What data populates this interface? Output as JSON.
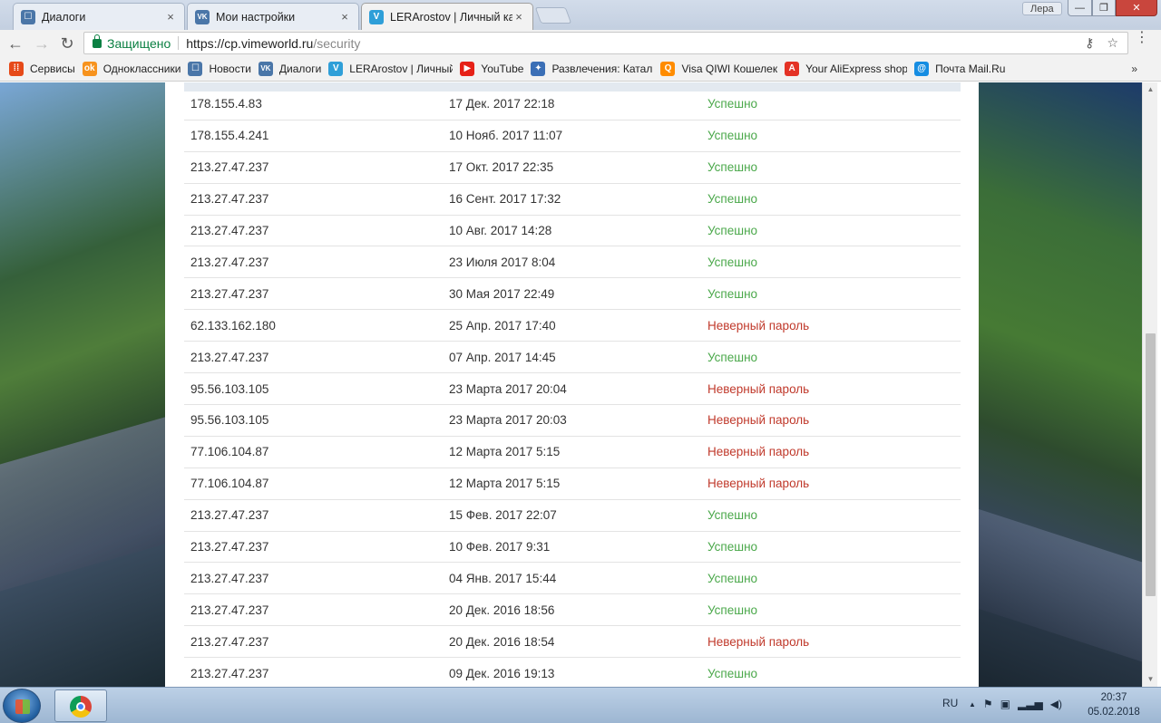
{
  "tabs": [
    {
      "title": "Диалоги",
      "close": "×",
      "icon": "vk-messages-icon",
      "color": "#4a76a8",
      "glyph": "☐"
    },
    {
      "title": "Мои настройки",
      "close": "×",
      "icon": "vk-icon",
      "color": "#4a76a8",
      "glyph": "VK"
    },
    {
      "title": "LERArostov | Личный ка",
      "close": "×",
      "icon": "vimeworld-icon",
      "color": "#2f9fd8",
      "glyph": "V"
    }
  ],
  "window": {
    "user": "Лера",
    "min": "—",
    "max": "❐",
    "close": "✕"
  },
  "toolbar": {
    "secure_label": "Защищено",
    "url_host": "https://cp.vimeworld.ru",
    "url_path": "/security",
    "back": "←",
    "forward": "→",
    "reload": "↻",
    "key_icon": "⚷",
    "star_icon": "☆",
    "menu": "⋮"
  },
  "bookmarks": {
    "items": [
      {
        "label": "Сервисы",
        "icon": "apps-grid-icon",
        "color": "#e64a19",
        "glyph": "⁞⁞"
      },
      {
        "label": "Одноклассники",
        "icon": "odnoklassniki-icon",
        "color": "#f7931e",
        "glyph": "ok"
      },
      {
        "label": "Новости",
        "icon": "vk-news-icon",
        "color": "#4a76a8",
        "glyph": "☐"
      },
      {
        "label": "Диалоги",
        "icon": "vk-icon",
        "color": "#4a76a8",
        "glyph": "VK"
      },
      {
        "label": "LERArostov | Личный",
        "icon": "vimeworld-icon",
        "color": "#2f9fd8",
        "glyph": "V"
      },
      {
        "label": "YouTube",
        "icon": "youtube-icon",
        "color": "#e62117",
        "glyph": "▶"
      },
      {
        "label": "Развлечения: Катало",
        "icon": "entertainment-icon",
        "color": "#3b6fb6",
        "glyph": "✦"
      },
      {
        "label": "Visa QIWI Кошелек",
        "icon": "qiwi-icon",
        "color": "#ff8c00",
        "glyph": "Q"
      },
      {
        "label": "Your AliExpress shop",
        "icon": "aliexpress-icon",
        "color": "#e43225",
        "glyph": "A"
      },
      {
        "label": "Почта Mail.Ru",
        "icon": "mailru-icon",
        "color": "#168de2",
        "glyph": "@"
      }
    ],
    "more": "»"
  },
  "security_log": {
    "rows": [
      {
        "ip": "178.155.4.83",
        "date": "17 Дек. 2017 22:18",
        "status": "Успешно",
        "ok": true
      },
      {
        "ip": "178.155.4.241",
        "date": "10 Нояб. 2017 11:07",
        "status": "Успешно",
        "ok": true
      },
      {
        "ip": "213.27.47.237",
        "date": "17 Окт. 2017 22:35",
        "status": "Успешно",
        "ok": true
      },
      {
        "ip": "213.27.47.237",
        "date": "16 Сент. 2017 17:32",
        "status": "Успешно",
        "ok": true
      },
      {
        "ip": "213.27.47.237",
        "date": "10 Авг. 2017 14:28",
        "status": "Успешно",
        "ok": true
      },
      {
        "ip": "213.27.47.237",
        "date": "23 Июля 2017 8:04",
        "status": "Успешно",
        "ok": true
      },
      {
        "ip": "213.27.47.237",
        "date": "30 Мая 2017 22:49",
        "status": "Успешно",
        "ok": true
      },
      {
        "ip": "62.133.162.180",
        "date": "25 Апр. 2017 17:40",
        "status": "Неверный пароль",
        "ok": false
      },
      {
        "ip": "213.27.47.237",
        "date": "07 Апр. 2017 14:45",
        "status": "Успешно",
        "ok": true
      },
      {
        "ip": "95.56.103.105",
        "date": "23 Марта 2017 20:04",
        "status": "Неверный пароль",
        "ok": false
      },
      {
        "ip": "95.56.103.105",
        "date": "23 Марта 2017 20:03",
        "status": "Неверный пароль",
        "ok": false
      },
      {
        "ip": "77.106.104.87",
        "date": "12 Марта 2017 5:15",
        "status": "Неверный пароль",
        "ok": false
      },
      {
        "ip": "77.106.104.87",
        "date": "12 Марта 2017 5:15",
        "status": "Неверный пароль",
        "ok": false
      },
      {
        "ip": "213.27.47.237",
        "date": "15 Фев. 2017 22:07",
        "status": "Успешно",
        "ok": true
      },
      {
        "ip": "213.27.47.237",
        "date": "10 Фев. 2017 9:31",
        "status": "Успешно",
        "ok": true
      },
      {
        "ip": "213.27.47.237",
        "date": "04 Янв. 2017 15:44",
        "status": "Успешно",
        "ok": true
      },
      {
        "ip": "213.27.47.237",
        "date": "20 Дек. 2016 18:56",
        "status": "Успешно",
        "ok": true
      },
      {
        "ip": "213.27.47.237",
        "date": "20 Дек. 2016 18:54",
        "status": "Неверный пароль",
        "ok": false
      },
      {
        "ip": "213.27.47.237",
        "date": "09 Дек. 2016 19:13",
        "status": "Успешно",
        "ok": true
      }
    ]
  },
  "colors": {
    "success": "#4aa84a",
    "failure": "#c0392b"
  },
  "taskbar": {
    "lang": "RU",
    "time": "20:37",
    "date": "05.02.2018",
    "tray_up": "▲"
  }
}
